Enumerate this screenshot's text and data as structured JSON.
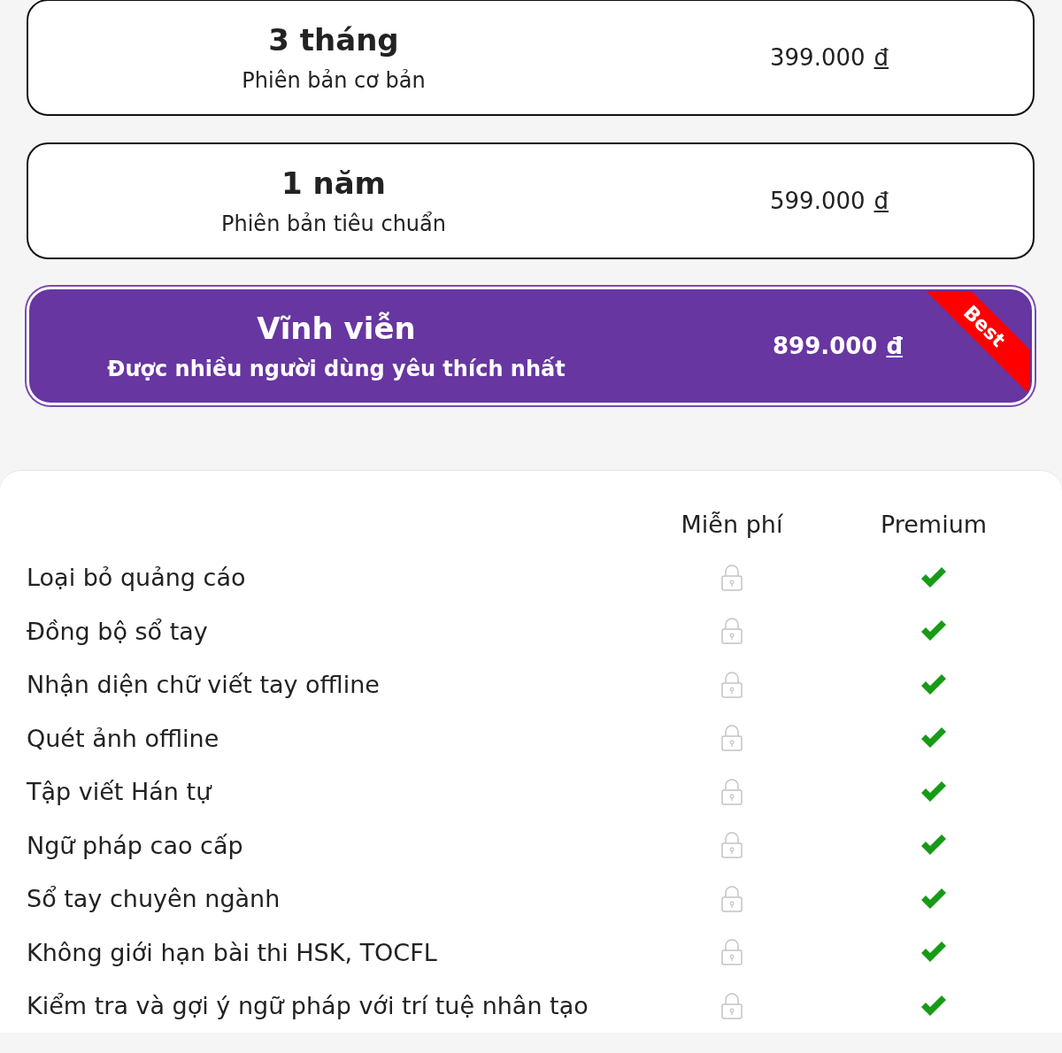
{
  "plans": [
    {
      "duration": "3 tháng",
      "subtitle": "Phiên bản cơ bản",
      "price": "399.000",
      "currency": "đ",
      "selected": false
    },
    {
      "duration": "1 năm",
      "subtitle": "Phiên bản tiêu chuẩn",
      "price": "599.000",
      "currency": "đ",
      "selected": false
    },
    {
      "duration": "Vĩnh viễn",
      "subtitle": "Được nhiều người dùng yêu thích nhất",
      "price": "899.000",
      "currency": "đ",
      "selected": true,
      "badge": "Best"
    }
  ],
  "comparison": {
    "columns": [
      "Miễn phí",
      "Premium"
    ],
    "rows": [
      {
        "feature": "Loại bỏ quảng cáo",
        "free": false,
        "premium": true
      },
      {
        "feature": "Đồng bộ sổ tay",
        "free": false,
        "premium": true
      },
      {
        "feature": "Nhận diện chữ viết tay offline",
        "free": false,
        "premium": true
      },
      {
        "feature": "Quét ảnh offline",
        "free": false,
        "premium": true
      },
      {
        "feature": "Tập viết Hán tự",
        "free": false,
        "premium": true
      },
      {
        "feature": "Ngữ pháp cao cấp",
        "free": false,
        "premium": true
      },
      {
        "feature": "Sổ tay chuyên ngành",
        "free": false,
        "premium": true
      },
      {
        "feature": "Không giới hạn bài thi HSK, TOCFL",
        "free": false,
        "premium": true
      },
      {
        "feature": "Kiểm tra và gợi ý ngữ pháp với trí tuệ nhân tạo",
        "free": false,
        "premium": true
      }
    ]
  }
}
